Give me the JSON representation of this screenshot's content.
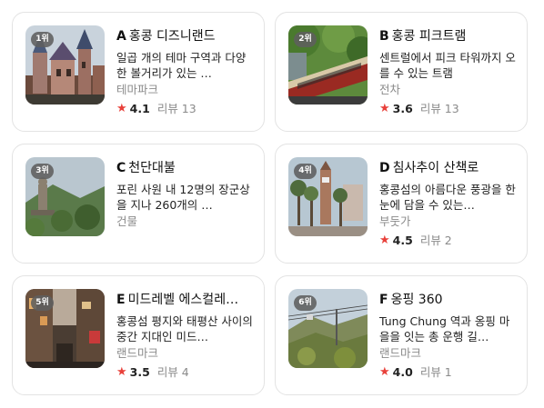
{
  "places": [
    {
      "rank": "1위",
      "letter": "A",
      "name": "홍콩 디즈니랜드",
      "description": "일곱 개의 테마 구역과 다양한 볼거리가 있는 …",
      "category": "테마파크",
      "rating": "4.1",
      "reviews": "리뷰 13",
      "thumbnail_icon": "castle-photo"
    },
    {
      "rank": "2위",
      "letter": "B",
      "name": "홍콩 피크트램",
      "description": "센트럴에서 피크 타워까지 오를 수 있는 트램",
      "category": "전차",
      "rating": "3.6",
      "reviews": "리뷰 13",
      "thumbnail_icon": "tram-photo"
    },
    {
      "rank": "3위",
      "letter": "C",
      "name": "천단대불",
      "description": "포린 사원 내 12명의 장군상을 지나 260개의 …",
      "category": "건물",
      "rating": "",
      "reviews": "",
      "thumbnail_icon": "statues-photo"
    },
    {
      "rank": "4위",
      "letter": "D",
      "name": "침사추이 산책로",
      "description": "홍콩섬의 아름다운 풍광을 한눈에 담을 수 있는…",
      "category": "부둣가",
      "rating": "4.5",
      "reviews": "리뷰 2",
      "thumbnail_icon": "clocktower-photo"
    },
    {
      "rank": "5위",
      "letter": "E",
      "name": "미드레벨 에스컬레…",
      "description": "홍콩섬 평지와 태평산 사이의 중간 지대인 미드…",
      "category": "랜드마크",
      "rating": "3.5",
      "reviews": "리뷰 4",
      "thumbnail_icon": "street-photo"
    },
    {
      "rank": "6위",
      "letter": "F",
      "name": "옹핑 360",
      "description": "Tung Chung 역과 옹핑 마을을 잇는 총 운행 길…",
      "category": "랜드마크",
      "rating": "4.0",
      "reviews": "리뷰 1",
      "thumbnail_icon": "cablecar-photo"
    }
  ],
  "colors": {
    "star": "#e8403a",
    "rank_badge": "#5f5f5f",
    "muted_text": "#8a8a8a",
    "card_border": "#e3e3e3"
  }
}
